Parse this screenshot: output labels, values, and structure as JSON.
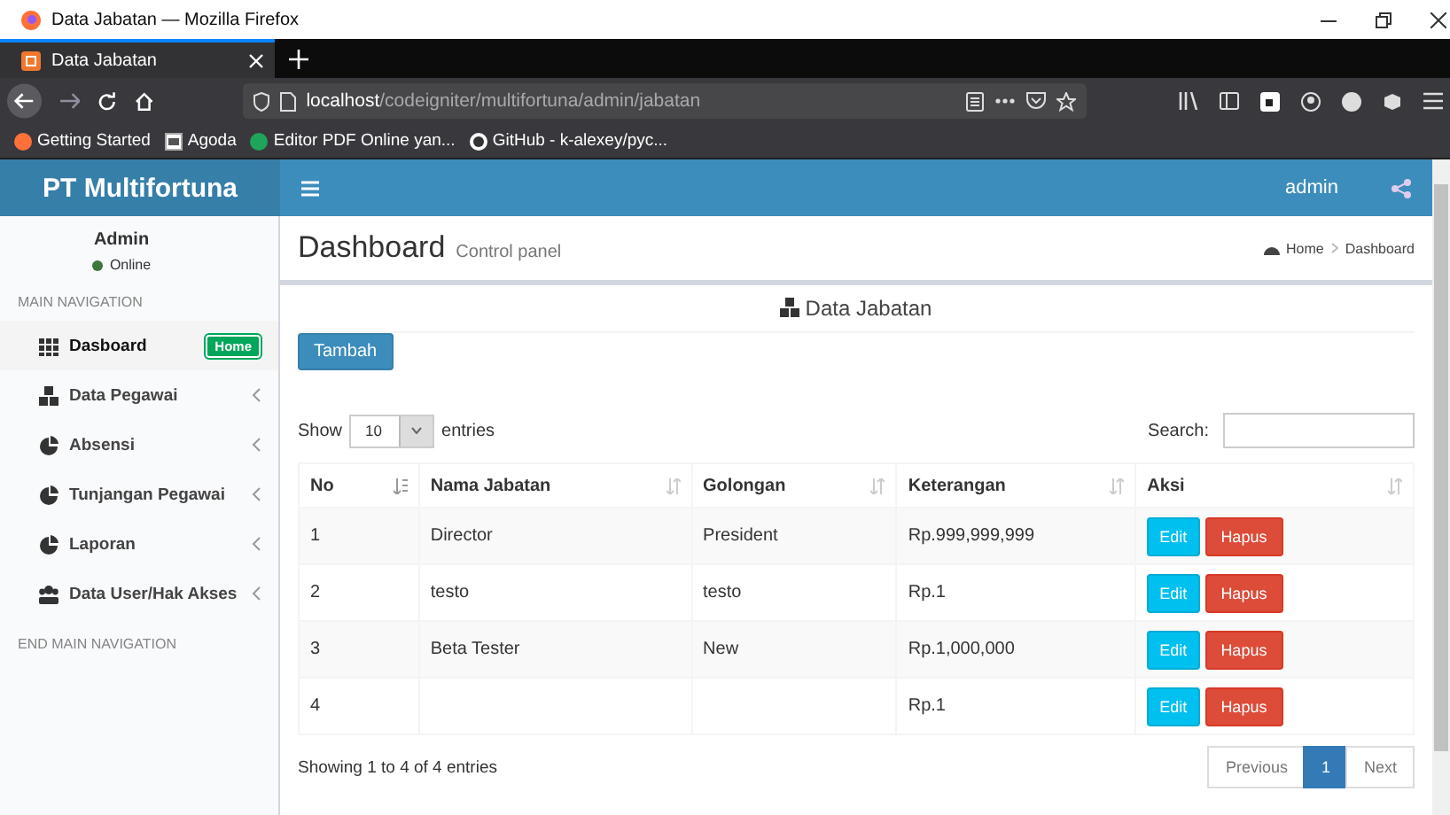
{
  "window": {
    "title": "Data Jabatan — Mozilla Firefox"
  },
  "browser": {
    "tabs": [
      {
        "label": "Data Jabatan",
        "selected": true
      }
    ],
    "url_host": "localhost",
    "url_path": "/codeigniter/multifortuna/admin/jabatan",
    "bookmarks": [
      {
        "label": "Getting Started",
        "kind": "firefox"
      },
      {
        "label": "Agoda",
        "kind": "page"
      },
      {
        "label": "Editor PDF Online yan...",
        "kind": "letter"
      },
      {
        "label": "GitHub - k-alexey/pyc...",
        "kind": "github"
      }
    ]
  },
  "header": {
    "brand": "PT Multifortuna",
    "user": "admin"
  },
  "sidebar": {
    "user": "Admin",
    "status": "Online",
    "section": "MAIN NAVIGATION",
    "items": [
      {
        "label": "Dasboard",
        "kind": "grid",
        "selected": true,
        "badge": "Home"
      },
      {
        "label": "Data Pegawai",
        "kind": "cubes",
        "selected": false
      },
      {
        "label": "Absensi",
        "kind": "pie",
        "selected": false
      },
      {
        "label": "Tunjangan Pegawai",
        "kind": "pie",
        "selected": false
      },
      {
        "label": "Laporan",
        "kind": "pie",
        "selected": false
      },
      {
        "label": "Data User/Hak Akses",
        "kind": "group",
        "selected": false
      }
    ],
    "footer": "END MAIN NAVIGATION"
  },
  "content": {
    "title": "Dashboard",
    "subtitle": "Control panel",
    "breadcrumb": [
      "Home",
      "Dashboard"
    ],
    "box_title": "Data Jabatan",
    "add_button": "Tambah",
    "show_label": "Show",
    "page_size": "10",
    "entries_label": "entries",
    "search_label": "Search:",
    "columns": [
      "No",
      "Nama Jabatan",
      "Golongan",
      "Keterangan",
      "Aksi"
    ],
    "rows": [
      {
        "no": "1",
        "nama": "Director",
        "golongan": "President",
        "keterangan": "Rp.999,999,999",
        "actions": [
          "Edit",
          "Hapus"
        ]
      },
      {
        "no": "2",
        "nama": "testo",
        "golongan": "testo",
        "keterangan": "Rp.1",
        "actions": [
          "Edit",
          "Hapus"
        ]
      },
      {
        "no": "3",
        "nama": "Beta Tester",
        "golongan": "New",
        "keterangan": "Rp.1,000,000",
        "actions": [
          "Edit",
          "Hapus"
        ]
      },
      {
        "no": "4",
        "keterangan": "Rp.1",
        "actions": [
          "Edit",
          "Hapus"
        ]
      }
    ],
    "info": "Showing 1 to 4 of 4 entries",
    "pagination": [
      {
        "label": "Previous",
        "selected": false
      },
      {
        "label": "1",
        "selected": true
      },
      {
        "label": "Next",
        "selected": false
      }
    ]
  }
}
